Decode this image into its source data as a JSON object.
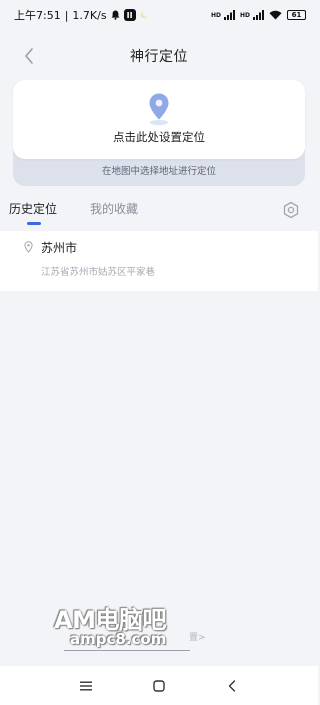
{
  "status_bar": {
    "time": "上午7:51",
    "speed": "1.7K/s",
    "app_badge": "II",
    "net_label_1": "HD",
    "net_label_2": "HD",
    "battery": "61"
  },
  "header": {
    "title": "神行定位"
  },
  "location_card": {
    "set_location": "点击此处设置定位",
    "map_select": "在地图中选择地址进行定位"
  },
  "tabs": [
    {
      "label": "历史定位",
      "active": true
    },
    {
      "label": "我的收藏",
      "active": false
    }
  ],
  "history": [
    {
      "city": "苏州市",
      "address": "江苏省苏州市姑苏区平家巷"
    }
  ],
  "watermark": {
    "main": "AM电脑吧",
    "sub": "ampc8.com",
    "faint": "置>"
  },
  "colors": {
    "accent": "#3E6AE1",
    "pin": "#8FA9E8",
    "background": "#F3F4F8"
  },
  "icons": {
    "back": "chevron-left-icon",
    "pin": "location-pin-icon",
    "settings": "settings-gear-icon",
    "nav_menu": "menu-icon",
    "nav_home": "home-square-icon",
    "nav_back": "back-icon"
  }
}
